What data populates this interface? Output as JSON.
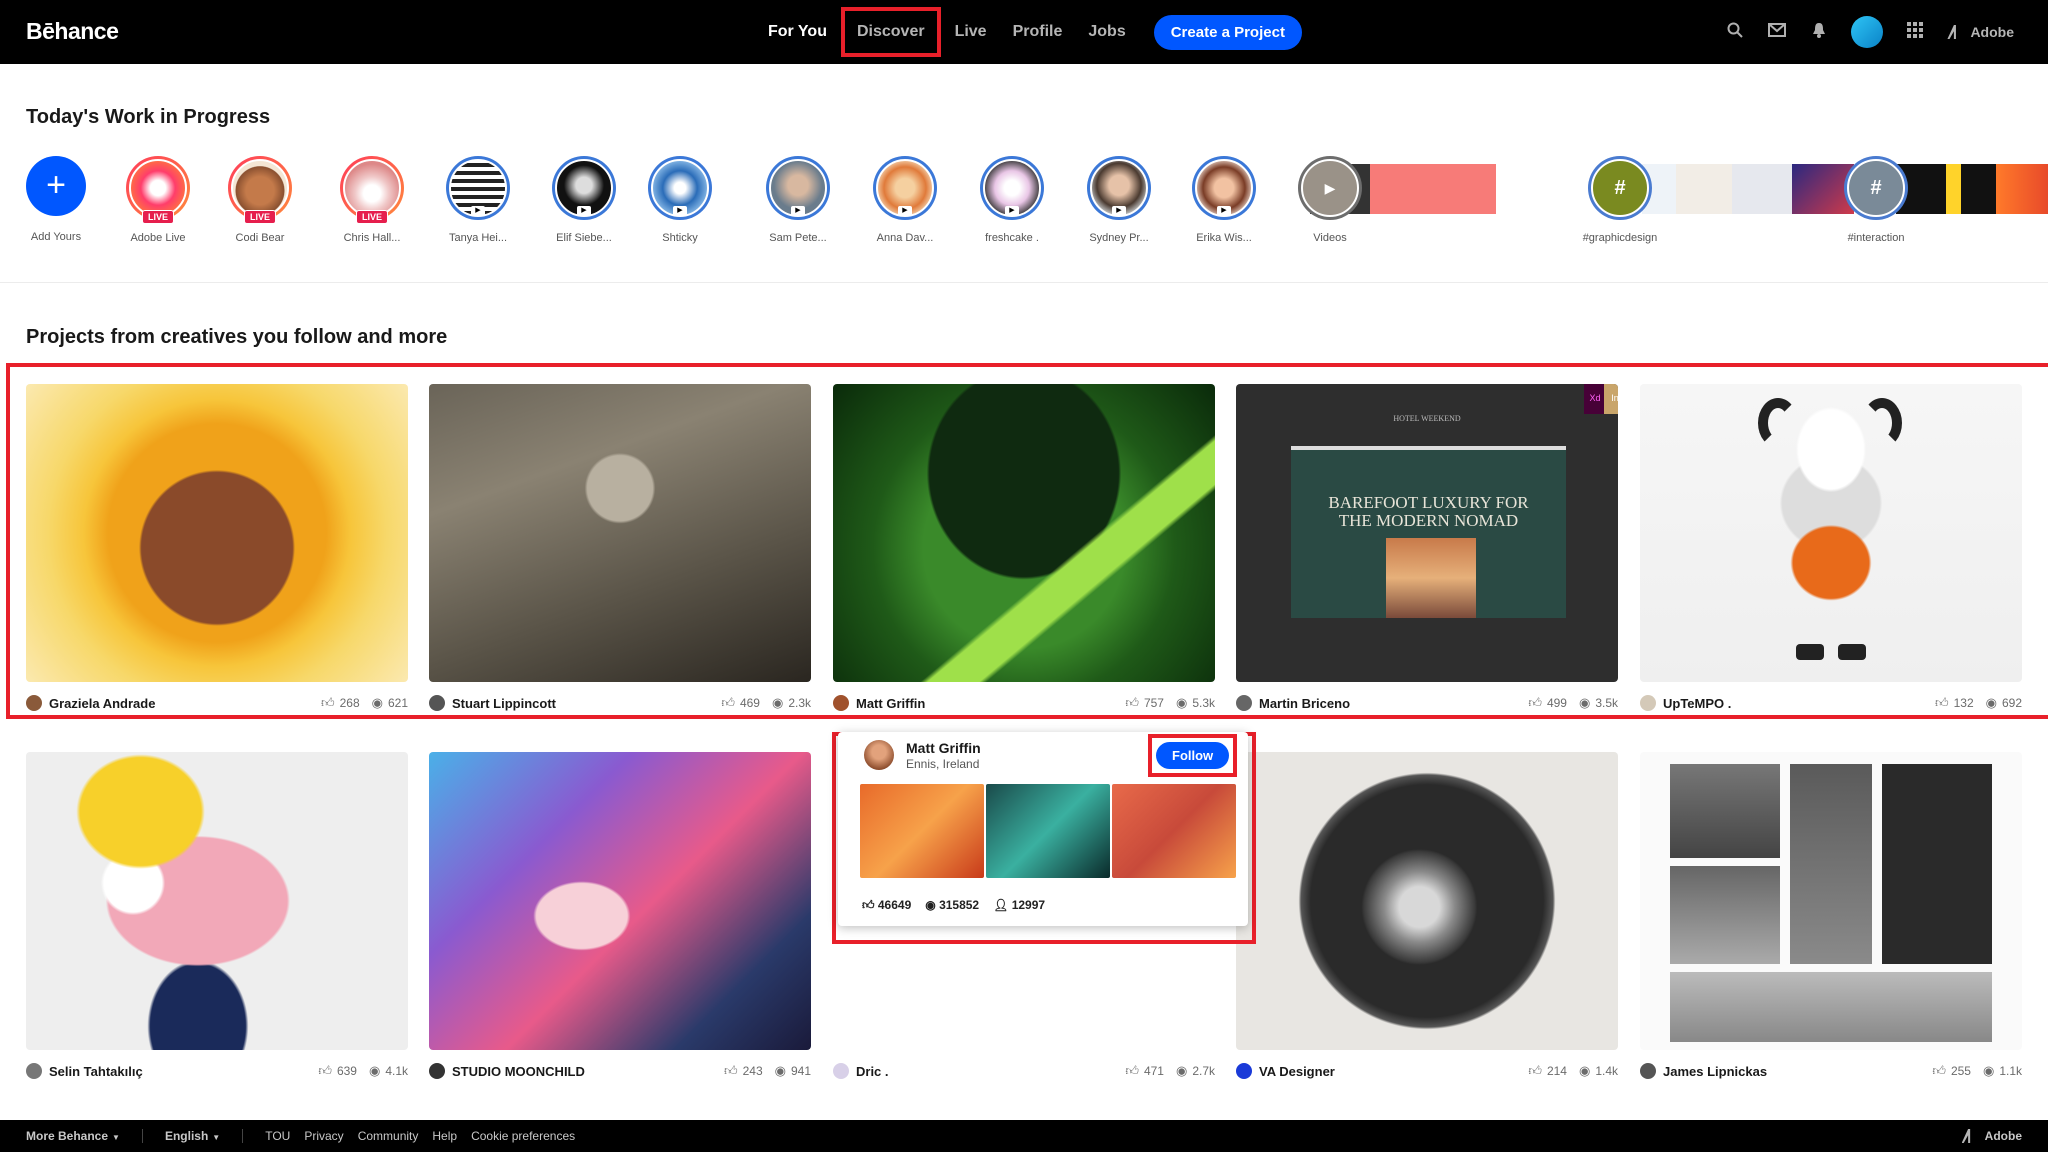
{
  "nav": {
    "logo": "Bēhance",
    "links": [
      "For You",
      "Discover",
      "Live",
      "Profile",
      "Jobs"
    ],
    "create_label": "Create a Project",
    "adobe_label": "Adobe"
  },
  "wip": {
    "title": "Today's Work in Progress",
    "add_label": "Add Yours",
    "stories": [
      {
        "name": "Adobe Live",
        "live": true,
        "live_label": "LIVE"
      },
      {
        "name": "Codi Bear",
        "live": true,
        "live_label": "LIVE"
      },
      {
        "name": "Chris Hall...",
        "live": true,
        "live_label": "LIVE"
      },
      {
        "name": "Tanya Hei..."
      },
      {
        "name": "Elif Siebe..."
      },
      {
        "name": "Shticky"
      },
      {
        "name": "Sam Pete..."
      },
      {
        "name": "Anna Dav..."
      },
      {
        "name": "freshcake ."
      },
      {
        "name": "Sydney Pr..."
      },
      {
        "name": "Erika Wis..."
      }
    ],
    "videos_label": "Videos",
    "tags": [
      "#graphicdesign",
      "#interaction"
    ]
  },
  "projects": {
    "title": "Projects from creatives you follow and more",
    "row1": [
      {
        "owner": "Graziela Andrade",
        "likes": "268",
        "views": "621"
      },
      {
        "owner": "Stuart Lippincott",
        "likes": "469",
        "views": "2.3k"
      },
      {
        "owner": "Matt Griffin",
        "likes": "757",
        "views": "5.3k"
      },
      {
        "owner": "Martin Briceno",
        "likes": "499",
        "views": "3.5k"
      },
      {
        "owner": "UpTeMPO .",
        "likes": "132",
        "views": "692"
      }
    ],
    "row2": [
      {
        "owner": "Selin Tahtakılıç",
        "likes": "639",
        "views": "4.1k"
      },
      {
        "owner": "STUDIO MOONCHILD",
        "likes": "243",
        "views": "941"
      },
      {
        "owner": "Dric .",
        "likes": "471",
        "views": "2.7k"
      },
      {
        "owner": "VA Designer",
        "likes": "214",
        "views": "1.4k"
      },
      {
        "owner": "James Lipnickas",
        "likes": "255",
        "views": "1.1k"
      }
    ],
    "thumb_text": {
      "hotel": "HOTEL WEEKEND",
      "headline": "BAREFOOT LUXURY FOR THE MODERN NOMAD",
      "badge_xd": "Xd",
      "badge_in": "In"
    }
  },
  "hover_card": {
    "name": "Matt Griffin",
    "location": "Ennis, Ireland",
    "follow_label": "Follow",
    "appreciations": "46649",
    "views": "315852",
    "followers": "12997"
  },
  "footer": {
    "more": "More Behance",
    "language": "English",
    "links": [
      "TOU",
      "Privacy",
      "Community",
      "Help",
      "Cookie preferences"
    ],
    "adobe": "Adobe"
  },
  "colors": {
    "accent": "#0057ff",
    "highlight": "#e8202a",
    "live": "#e61e4d"
  }
}
